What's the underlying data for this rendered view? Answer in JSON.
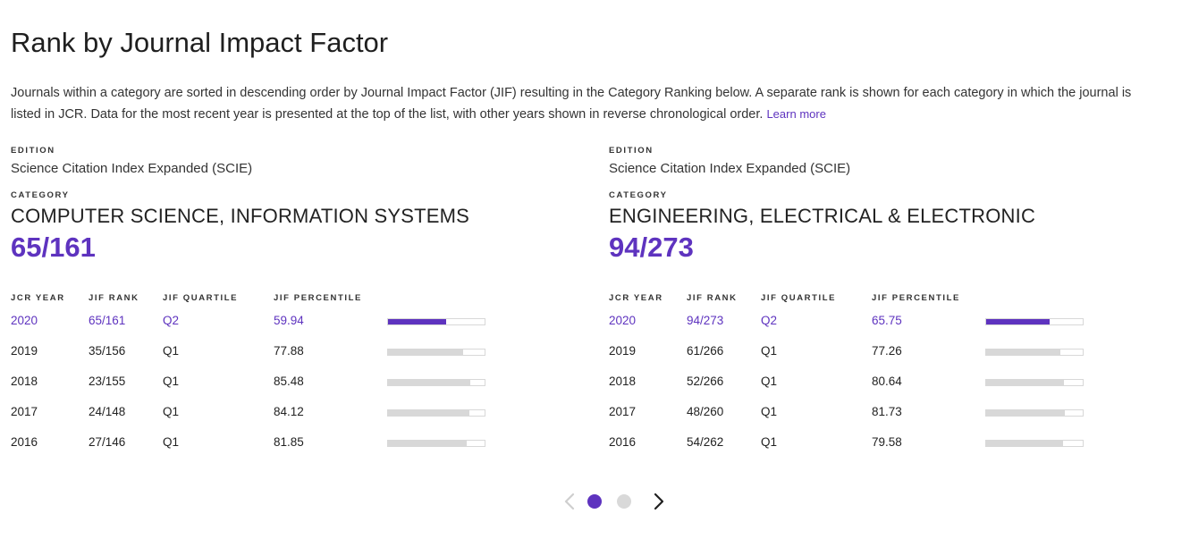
{
  "page": {
    "title": "Rank by Journal Impact Factor",
    "intro": "Journals within a category are sorted in descending order by Journal Impact Factor (JIF) resulting in the Category Ranking below. A separate rank is shown for each category in which the journal is listed in JCR. Data for the most recent year is presented at the top of the list, with other years shown in reverse chronological order.",
    "learn_more": "Learn more"
  },
  "labels": {
    "edition": "EDITION",
    "category": "CATEGORY",
    "col_year": "JCR YEAR",
    "col_rank": "JIF RANK",
    "col_quartile": "JIF QUARTILE",
    "col_percentile": "JIF PERCENTILE"
  },
  "colors": {
    "accent": "#5e33bf",
    "bar_inactive": "#d8d8d8",
    "dot_inactive": "#d9d9d9"
  },
  "panels": [
    {
      "edition": "Science Citation Index Expanded (SCIE)",
      "category": "COMPUTER SCIENCE, INFORMATION SYSTEMS",
      "rank": "65/161",
      "rows": [
        {
          "year": "2020",
          "rank": "65/161",
          "quartile": "Q2",
          "percentile": "59.94",
          "fill": 0.5994,
          "current": true
        },
        {
          "year": "2019",
          "rank": "35/156",
          "quartile": "Q1",
          "percentile": "77.88",
          "fill": 0.7788,
          "current": false
        },
        {
          "year": "2018",
          "rank": "23/155",
          "quartile": "Q1",
          "percentile": "85.48",
          "fill": 0.8548,
          "current": false
        },
        {
          "year": "2017",
          "rank": "24/148",
          "quartile": "Q1",
          "percentile": "84.12",
          "fill": 0.8412,
          "current": false
        },
        {
          "year": "2016",
          "rank": "27/146",
          "quartile": "Q1",
          "percentile": "81.85",
          "fill": 0.8185,
          "current": false
        }
      ]
    },
    {
      "edition": "Science Citation Index Expanded (SCIE)",
      "category": "ENGINEERING, ELECTRICAL & ELECTRONIC",
      "rank": "94/273",
      "rows": [
        {
          "year": "2020",
          "rank": "94/273",
          "quartile": "Q2",
          "percentile": "65.75",
          "fill": 0.6575,
          "current": true
        },
        {
          "year": "2019",
          "rank": "61/266",
          "quartile": "Q1",
          "percentile": "77.26",
          "fill": 0.7726,
          "current": false
        },
        {
          "year": "2018",
          "rank": "52/266",
          "quartile": "Q1",
          "percentile": "80.64",
          "fill": 0.8064,
          "current": false
        },
        {
          "year": "2017",
          "rank": "48/260",
          "quartile": "Q1",
          "percentile": "81.73",
          "fill": 0.8173,
          "current": false
        },
        {
          "year": "2016",
          "rank": "54/262",
          "quartile": "Q1",
          "percentile": "79.58",
          "fill": 0.7958,
          "current": false
        }
      ]
    }
  ],
  "carousel": {
    "slide_count": 2,
    "active_index": 0,
    "prev_icon": "chevron-left-icon",
    "next_icon": "chevron-right-icon"
  }
}
